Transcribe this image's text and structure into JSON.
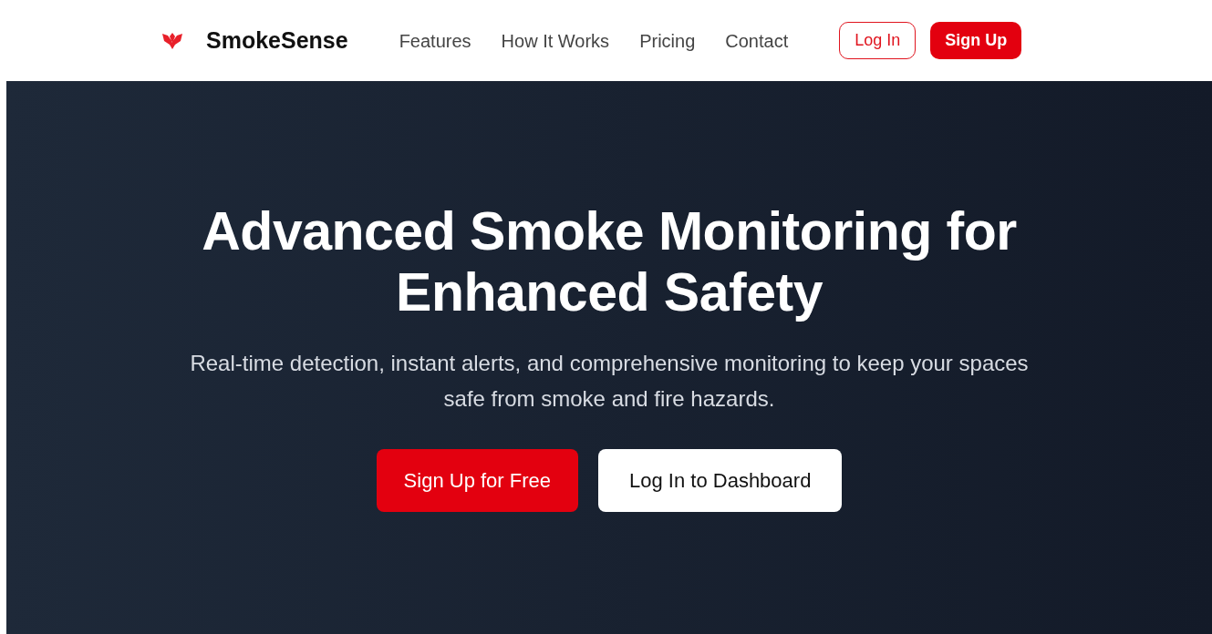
{
  "navbar": {
    "brand": "SmokeSense",
    "links": [
      "Features",
      "How It Works",
      "Pricing",
      "Contact"
    ],
    "buttons": [
      {
        "label": "Log In",
        "kind": "outline"
      },
      {
        "label": "Sign Up",
        "kind": "solid"
      }
    ]
  },
  "hero": {
    "title": "Advanced Smoke Monitoring for Enhanced Safety",
    "subtitle": "Real-time detection, instant alerts, and comprehensive monitoring to keep your spaces safe from smoke and fire hazards.",
    "buttons": [
      {
        "label": "Sign Up for Free",
        "kind": "solid"
      },
      {
        "label": "Log In to Dashboard",
        "kind": "light"
      }
    ]
  }
}
